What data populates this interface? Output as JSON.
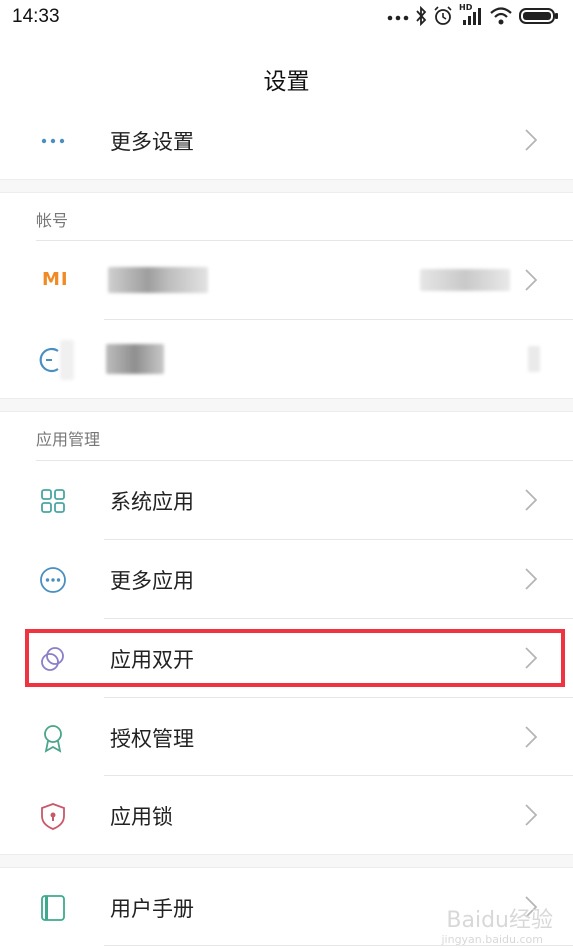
{
  "status_bar": {
    "time": "14:33",
    "icons": [
      "more-dots-icon",
      "bluetooth-icon",
      "alarm-icon",
      "signal-icon",
      "wifi-icon",
      "battery-icon"
    ],
    "hd_label": "HD"
  },
  "header": {
    "title": "设置"
  },
  "top_item": {
    "label": "更多设置",
    "icon": "more-dots-icon"
  },
  "account_section": {
    "title": "帐号",
    "mi_logo": "MI"
  },
  "app_section": {
    "title": "应用管理",
    "items": [
      {
        "label": "系统应用",
        "icon": "grid-icon"
      },
      {
        "label": "更多应用",
        "icon": "more-circle-icon"
      },
      {
        "label": "应用双开",
        "icon": "dual-app-icon"
      },
      {
        "label": "授权管理",
        "icon": "badge-icon"
      },
      {
        "label": "应用锁",
        "icon": "shield-lock-icon"
      }
    ]
  },
  "bottom_item": {
    "label": "用户手册",
    "icon": "manual-icon"
  },
  "watermark": {
    "text": "Baidu经验",
    "sub": "jingyan.baidu.com"
  },
  "colors": {
    "highlight": "#ef3340",
    "accent_blue": "#4a8fc0",
    "mi_orange": "#f08a24"
  }
}
